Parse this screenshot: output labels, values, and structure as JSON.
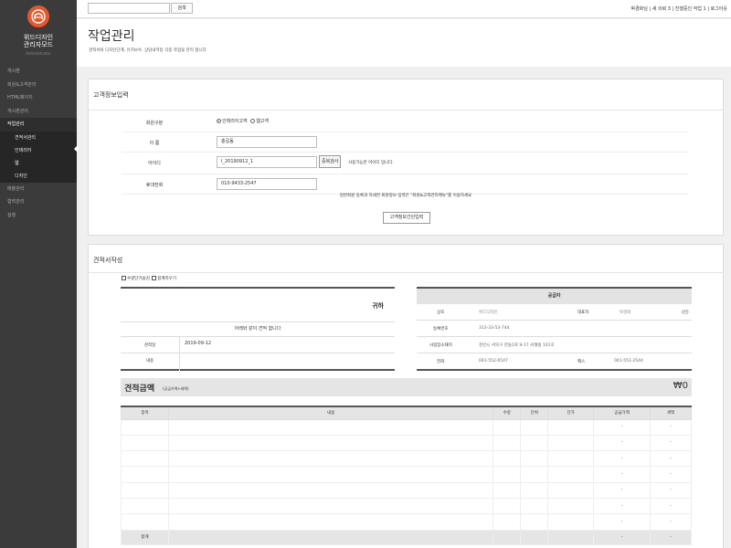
{
  "sidebar": {
    "brand_line1": "위드디자인",
    "brand_line2": "관리자모드",
    "brand_sub": "Administrator",
    "items": [
      {
        "label": "게시판"
      },
      {
        "label": "회원&고객관리"
      },
      {
        "label": "HTML페이지"
      },
      {
        "label": "게시판관리"
      },
      {
        "label": "작업관리"
      }
    ],
    "sub_items": [
      {
        "label": "견적서관리"
      },
      {
        "label": "인테리어"
      },
      {
        "label": "웹"
      },
      {
        "label": "디자인"
      }
    ],
    "items_after": [
      {
        "label": "매출관리"
      },
      {
        "label": "협력관리"
      },
      {
        "label": "설정"
      }
    ]
  },
  "topbar": {
    "search_placeholder": "",
    "search_btn": "검색",
    "user_links": "박경화님 | 새 의뢰 3 | 진행중인 작업 1 | 로그아웃"
  },
  "page": {
    "title": "작업관리",
    "desc": "견적서와 디자인단계, 유지보수, 상담내역등 각종 작업을 관리 합니다"
  },
  "customer": {
    "title": "고객정보입력",
    "member_label": "회원구분",
    "radio1": "인테리어고객",
    "radio2": "웹고객",
    "name_label": "이 름",
    "name_value": "홍길동",
    "id_label": "아이디",
    "id_value": "I_20190912_1",
    "dup_btn": "중복검사",
    "dup_msg": "사용가능한 아이디 입니다.",
    "phone_label": "휴대전화",
    "phone_value": "010-9433-2547",
    "notice": "일반회원 등록과 자세한 회원정보 입력은 \"회원&고객관리메뉴\"를 이용하세요",
    "submit": "고객정보간단입력"
  },
  "estimate": {
    "title": "견적서작성",
    "check1": "수량단가숨김",
    "check2": "합계지우기",
    "to": "귀하",
    "greeting": "아래와 같이 견적 합니다",
    "date_label": "견적일",
    "date_value": "2019-09-12",
    "content_label": "내용",
    "supplier": {
      "head": "공급자",
      "name_label": "상호",
      "name_value": "위드디자인",
      "rep_label": "대표자",
      "rep_value": "박경화",
      "seal": "(인)",
      "reg_label": "등록번호",
      "reg_value": "313-33-53-744",
      "addr_label": "사업장소재지",
      "addr_value": "천안시 서북구 한들1로 9-17 서해빌 101호",
      "tel_label": "전화",
      "tel_value": "041-552-6547",
      "fax_label": "팩스",
      "fax_value": "041-551-2544"
    },
    "amount_title": "견적금액",
    "amount_sub": "(공급가액+세액)",
    "amount_value": "₩0",
    "table": {
      "headers": [
        "종목",
        "내용",
        "수량",
        "단위",
        "단가",
        "공급가액",
        "세액"
      ],
      "rows": [
        {
          "supply": "-",
          "tax": "-"
        },
        {
          "supply": "-",
          "tax": "-"
        },
        {
          "supply": "-",
          "tax": "-"
        },
        {
          "supply": "-",
          "tax": "-"
        },
        {
          "supply": "-",
          "tax": "-"
        },
        {
          "supply": "-",
          "tax": "-"
        },
        {
          "supply": "-",
          "tax": "-"
        }
      ],
      "total_label": "합계",
      "total_supply": "-",
      "total_tax": "-"
    }
  }
}
